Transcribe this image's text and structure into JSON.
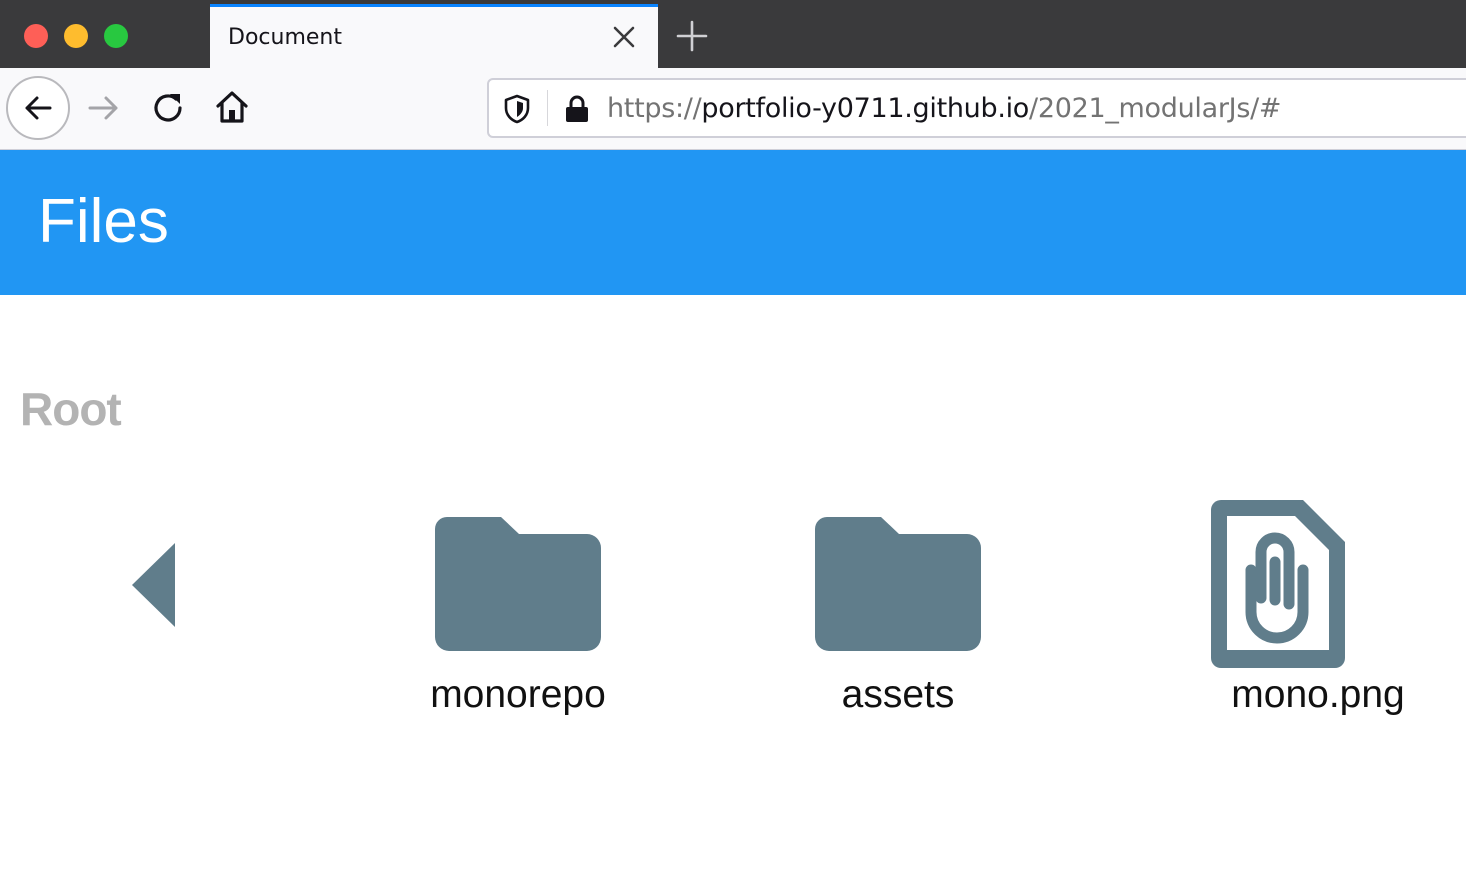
{
  "browser": {
    "tab_title": "Document",
    "url": {
      "scheme": "https://",
      "host": "portfolio-y0711.github.io",
      "path": "/2021_modularJs/#"
    },
    "icons": {
      "close_tab": "close-icon",
      "new_tab": "plus-icon",
      "back": "arrow-left-icon",
      "forward": "arrow-right-icon",
      "reload": "reload-icon",
      "home": "home-icon",
      "tracking": "shield-icon",
      "security": "lock-icon"
    }
  },
  "app": {
    "header_title": "Files",
    "header_color": "#2196f3",
    "breadcrumb": "Root",
    "icon_color": "#607d8b",
    "nodes": [
      {
        "type": "prev",
        "icon": "triangle-left-icon"
      },
      {
        "type": "directory",
        "name": "monorepo",
        "icon": "folder-icon"
      },
      {
        "type": "directory",
        "name": "assets",
        "icon": "folder-icon"
      },
      {
        "type": "file",
        "name": "mono.png",
        "icon": "file-attachment-icon"
      }
    ]
  }
}
